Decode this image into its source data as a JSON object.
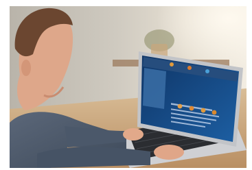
{
  "image": {
    "subject": "person-using-laptop",
    "colors": {
      "wall": "#c7c2b8",
      "window_light": "#f4efe4",
      "table": "#c9a57c",
      "sweater": "#4e5c6f",
      "skin": "#e0a889",
      "hair": "#6e4a33",
      "laptop_body": "#c8c9cc",
      "screen_bg": "#123f7a",
      "screen_panel": "#1b5c9f"
    }
  }
}
